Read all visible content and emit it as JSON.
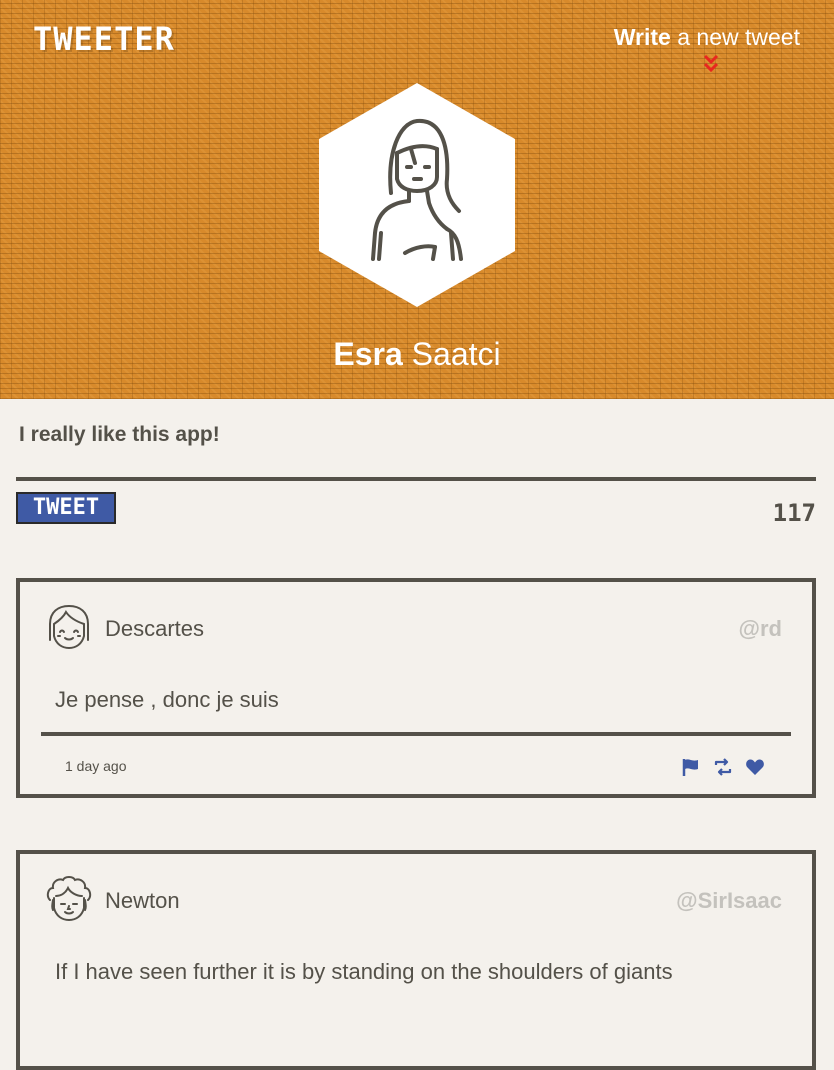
{
  "header": {
    "brand": "TWEETER",
    "compose_bold": "Write",
    "compose_rest": " a new tweet",
    "profile_first": "Esra",
    "profile_last": "Saatci",
    "background_color": "#d88a2b"
  },
  "composer": {
    "text": "I really like this app!",
    "button_label": "TWEET",
    "char_counter": "117"
  },
  "tweets": [
    {
      "name": "Descartes",
      "handle": "@rd",
      "body": "Je pense , donc je suis",
      "time": "1 day ago",
      "avatar_icon": "girl-avatar-icon",
      "actions": [
        "flag-icon",
        "retweet-icon",
        "heart-icon"
      ]
    },
    {
      "name": "Newton",
      "handle": "@SirIsaac",
      "body": "If I have seen further it is by standing on the shoulders of giants",
      "avatar_icon": "curly-hair-avatar-icon"
    }
  ],
  "colors": {
    "accent": "#3f5aa5",
    "text": "#545149",
    "muted_handle": "#c4c2bd",
    "compose_arrow": "#e8271f"
  }
}
